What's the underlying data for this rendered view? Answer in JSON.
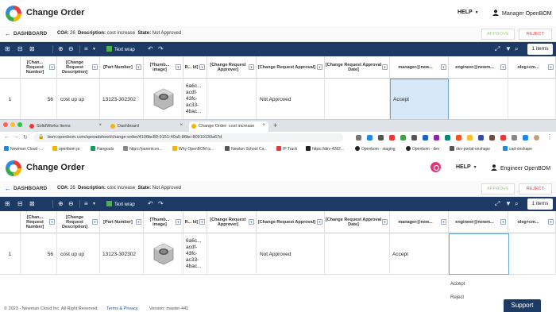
{
  "app": {
    "title": "Change Order",
    "help_label": "HELP"
  },
  "top": {
    "user_label": "Manager OpenBOM"
  },
  "bottom": {
    "user_label": "Engineer OpenBOM"
  },
  "subbar": {
    "back_label": "DASHBOARD",
    "co_label": "CO#:",
    "co_number": "26",
    "description_label": "Description:",
    "description_value": "cost increase",
    "state_label": "State:",
    "state_value": "Not Approved",
    "approve_label": "APPROVE",
    "reject_label": "REJECT"
  },
  "toolbar": {
    "text_wrap_label": "Text wrap",
    "items_count": "1 items"
  },
  "grid": {
    "columns": [
      "[Chan... Request Number]",
      "[Change Request Description]",
      "[Part Number]",
      "[Thumb... image]",
      "R... Id]",
      "[Change Request Approver]",
      "[Change Request Approval]",
      "[Change Request Approval Date]",
      "manager@new...",
      "engineer@newm...",
      "oleg+cm..."
    ],
    "row": {
      "index": "1",
      "number": "56",
      "description": "cost up up",
      "part_number": "13123-302302",
      "rid": "6a6c... acdf- 43fc- ac33- 4bac...",
      "approver": "",
      "approval": "Not Approved",
      "approval_date": "",
      "manager": "Accept",
      "engineer": "",
      "oleg": ""
    }
  },
  "browser": {
    "tabs": [
      "SolidWorks Items",
      "Dashboard",
      "Change Order: cost increase"
    ],
    "url": "bom.openbom.com/spreadsheet/change-order/4106bc80-9151-40a5-86bc-80910130a67d",
    "bookmarks": [
      "Newman Cloud -...",
      "openbom pr",
      "Hangouts",
      "https://parentcon...",
      "Why OpenBOM is...",
      "Newton School Ca...",
      "IP Track",
      "https://dev-4282...",
      "Openbom - staging",
      "Openbom - dev",
      "dev-portal-onshape",
      "cad-onshape"
    ]
  },
  "dropdown": {
    "options": [
      "Accept",
      "Reject"
    ]
  },
  "footer": {
    "copyright": "© 2023 - Newman Cloud Inc. All Right Reserved.",
    "terms": "Terms & Privacy",
    "version": "Version: master-441"
  },
  "support_label": "Support",
  "colors": {
    "toolbar": "#1c3a63",
    "accent": "#1a5aa8",
    "approve": "#9ccc78",
    "reject": "#e23b3b",
    "selected_cell": "#d6e8f7"
  }
}
